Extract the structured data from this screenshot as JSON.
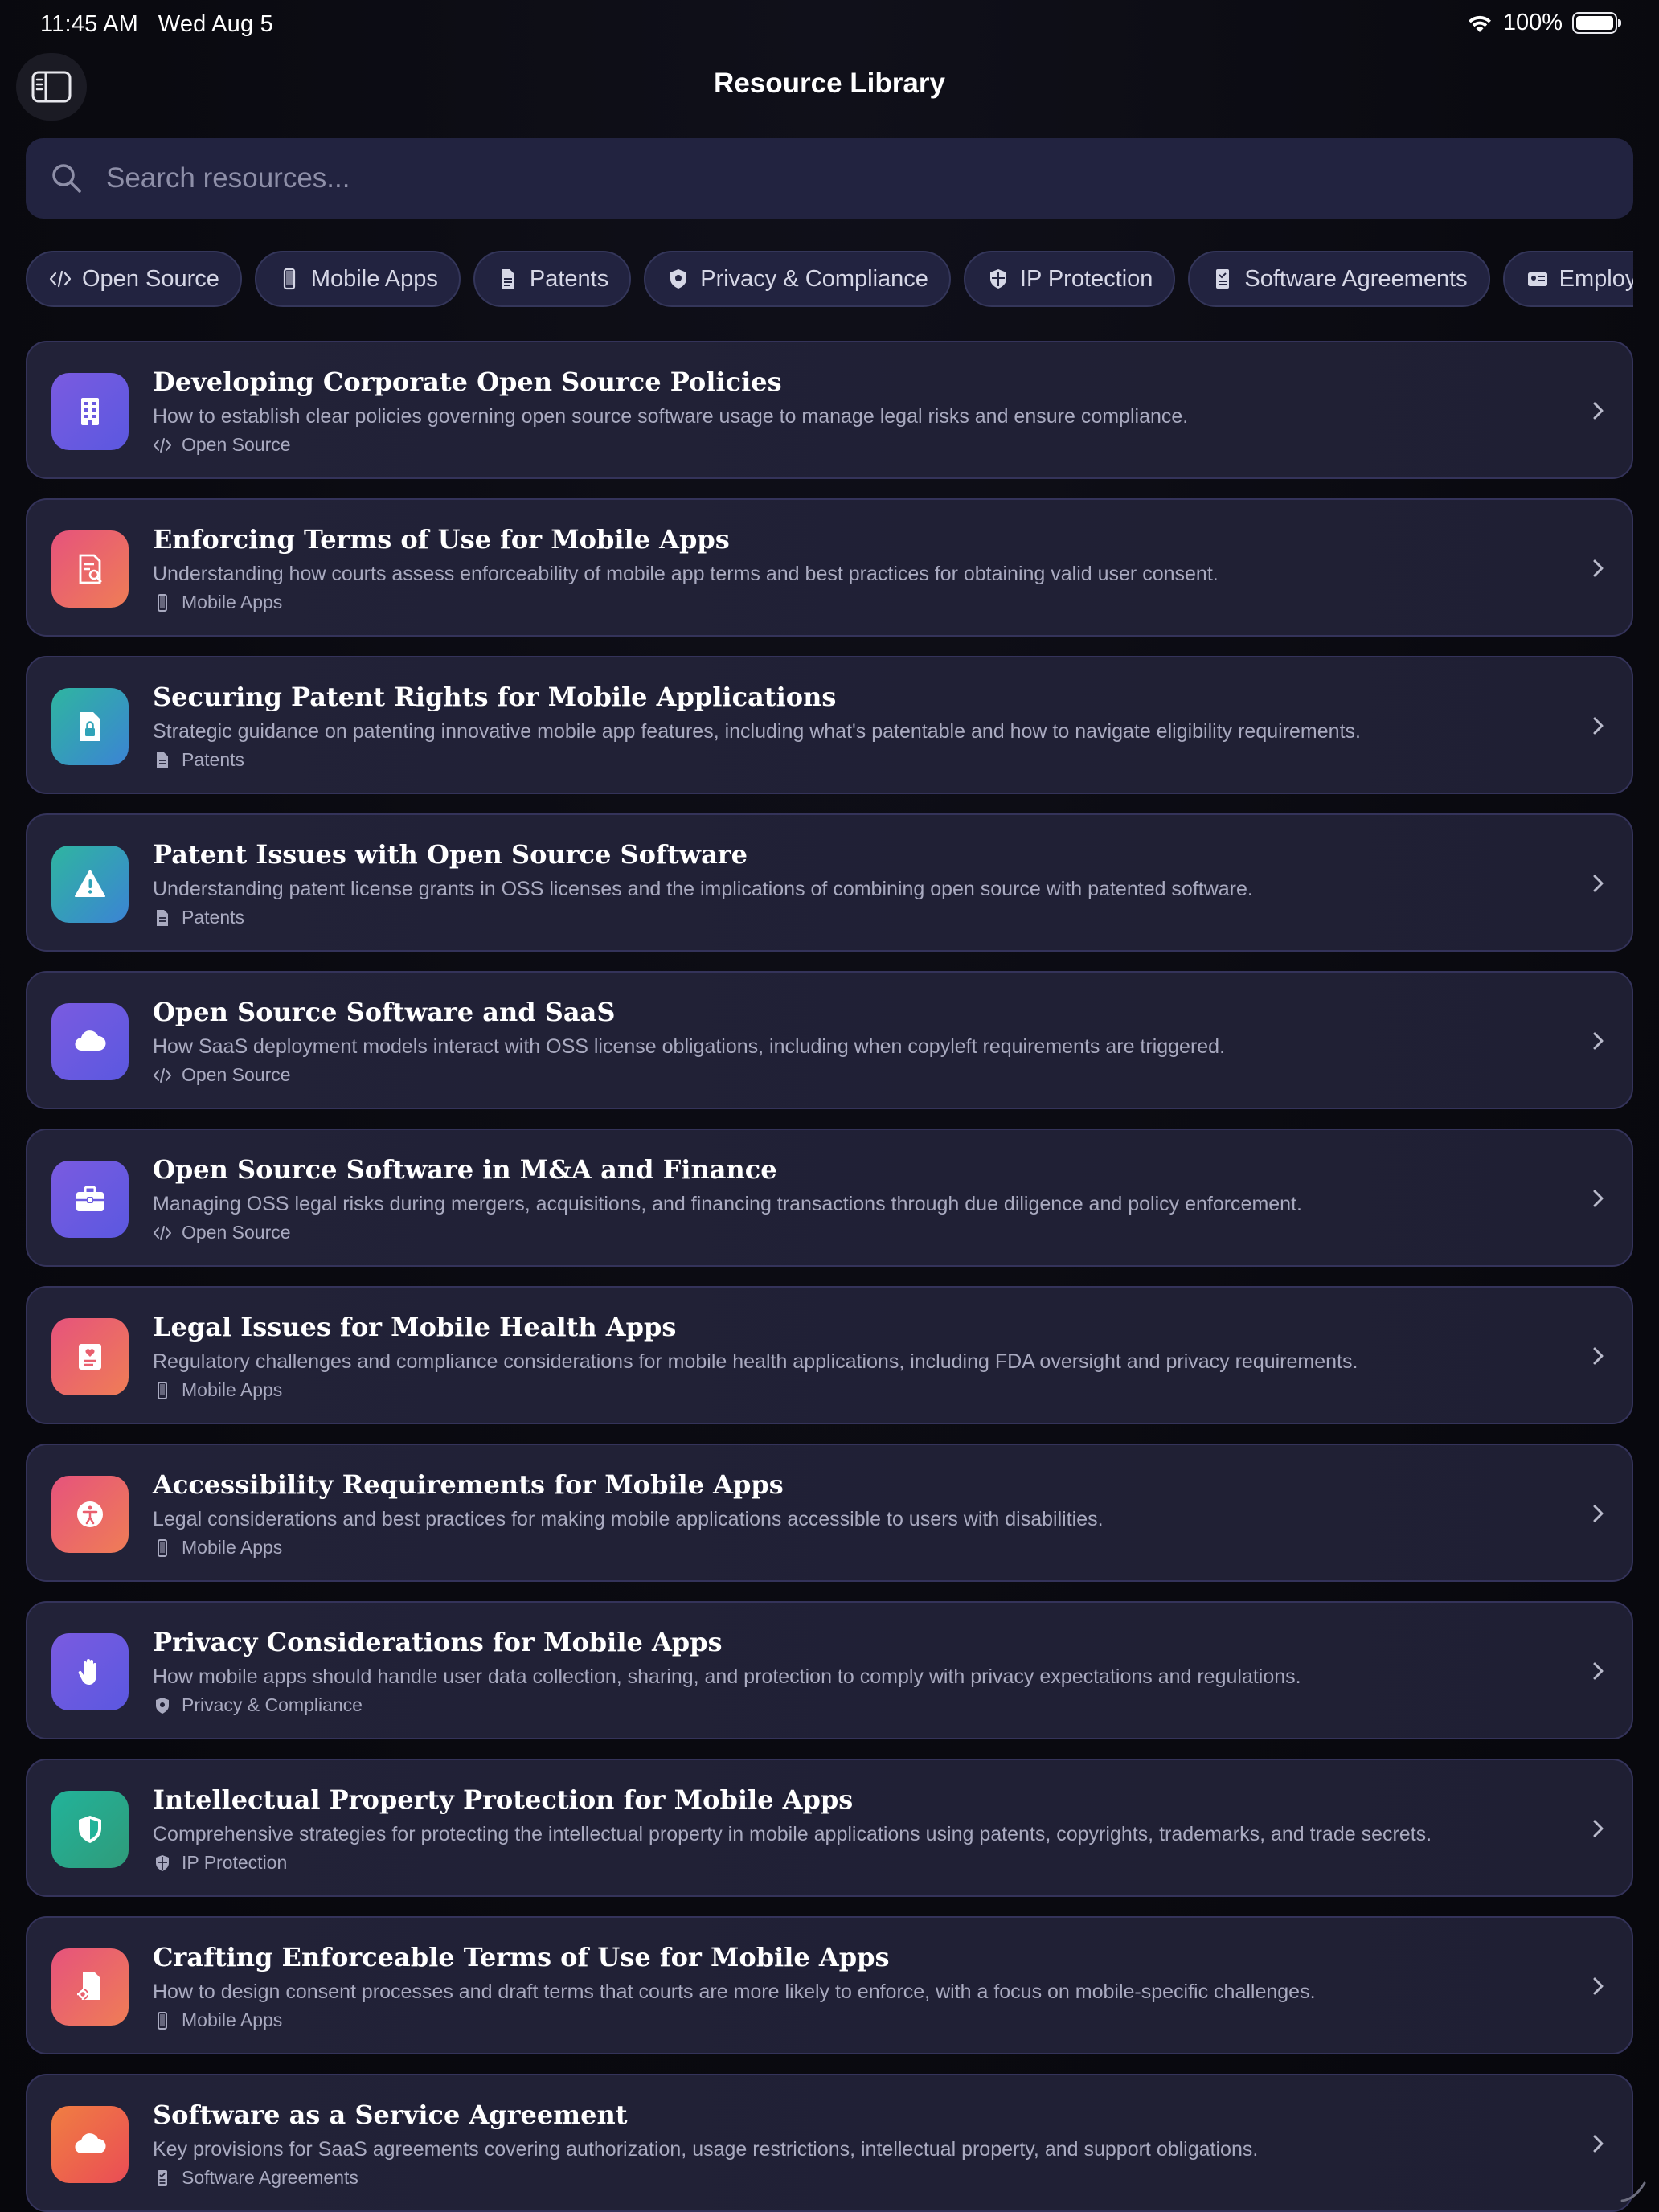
{
  "status_bar": {
    "time": "11:45 AM",
    "date": "Wed Aug 5",
    "battery": "100%"
  },
  "nav": {
    "title": "Resource Library"
  },
  "search": {
    "placeholder": "Search resources..."
  },
  "chips": [
    {
      "label": "Open Source",
      "icon": "code-icon"
    },
    {
      "label": "Mobile Apps",
      "icon": "phone-icon"
    },
    {
      "label": "Patents",
      "icon": "document-icon"
    },
    {
      "label": "Privacy & Compliance",
      "icon": "shield-icon"
    },
    {
      "label": "IP Protection",
      "icon": "shield-check-icon"
    },
    {
      "label": "Software Agreements",
      "icon": "contract-icon"
    },
    {
      "label": "Employment &",
      "icon": "id-card-icon"
    }
  ],
  "resources": [
    {
      "title": "Developing Corporate Open Source Policies",
      "description": "How to establish clear policies governing open source software usage to manage legal risks and ensure compliance.",
      "tag": "Open Source",
      "icon": "building-icon",
      "color": "#6a5ae0"
    },
    {
      "title": "Enforcing Terms of Use for Mobile Apps",
      "description": "Understanding how courts assess enforceability of mobile app terms and best practices for obtaining valid user consent.",
      "tag": "Mobile Apps",
      "icon": "document-search-icon",
      "color": "#e95f6e"
    },
    {
      "title": "Securing Patent Rights for Mobile Applications",
      "description": "Strategic guidance on patenting innovative mobile app features, including what's patentable and how to navigate eligibility requirements.",
      "tag": "Patents",
      "icon": "document-lock-icon",
      "color": "#30a3b8"
    },
    {
      "title": "Patent Issues with Open Source Software",
      "description": "Understanding patent license grants in OSS licenses and the implications of combining open source with patented software.",
      "tag": "Patents",
      "icon": "warning-icon",
      "color": "#30a3b8"
    },
    {
      "title": "Open Source Software and SaaS",
      "description": "How SaaS deployment models interact with OSS license obligations, including when copyleft requirements are triggered.",
      "tag": "Open Source",
      "icon": "cloud-icon",
      "color": "#6a5ae0"
    },
    {
      "title": "Open Source Software in M&A and Finance",
      "description": "Managing OSS legal risks during mergers, acquisitions, and financing transactions through due diligence and policy enforcement.",
      "tag": "Open Source",
      "icon": "briefcase-icon",
      "color": "#6a5ae0"
    },
    {
      "title": "Legal Issues for Mobile Health Apps",
      "description": "Regulatory challenges and compliance considerations for mobile health applications, including FDA oversight and privacy requirements.",
      "tag": "Mobile Apps",
      "icon": "health-record-icon",
      "color": "#e95f6e"
    },
    {
      "title": "Accessibility Requirements for Mobile Apps",
      "description": "Legal considerations and best practices for making mobile applications accessible to users with disabilities.",
      "tag": "Mobile Apps",
      "icon": "accessibility-icon",
      "color": "#e95f6e"
    },
    {
      "title": "Privacy Considerations for Mobile Apps",
      "description": "How mobile apps should handle user data collection, sharing, and protection to comply with privacy expectations and regulations.",
      "tag": "Privacy & Compliance",
      "icon": "hand-icon",
      "color": "#6a5ae0"
    },
    {
      "title": "Intellectual Property Protection for Mobile Apps",
      "description": "Comprehensive strategies for protecting the intellectual property in mobile applications using patents, copyrights, trademarks, and trade secrets.",
      "tag": "IP Protection",
      "icon": "shield-half-icon",
      "color": "#22b39a"
    },
    {
      "title": "Crafting Enforceable Terms of Use for Mobile Apps",
      "description": "How to design consent processes and draft terms that courts are more likely to enforce, with a focus on mobile-specific challenges.",
      "tag": "Mobile Apps",
      "icon": "document-gear-icon",
      "color": "#e95f6e"
    },
    {
      "title": "Software as a Service Agreement",
      "description": "Key provisions for SaaS agreements covering authorization, usage restrictions, intellectual property, and support obligations.",
      "tag": "Software Agreements",
      "icon": "cloud-icon",
      "color": "#ef6a48"
    }
  ]
}
